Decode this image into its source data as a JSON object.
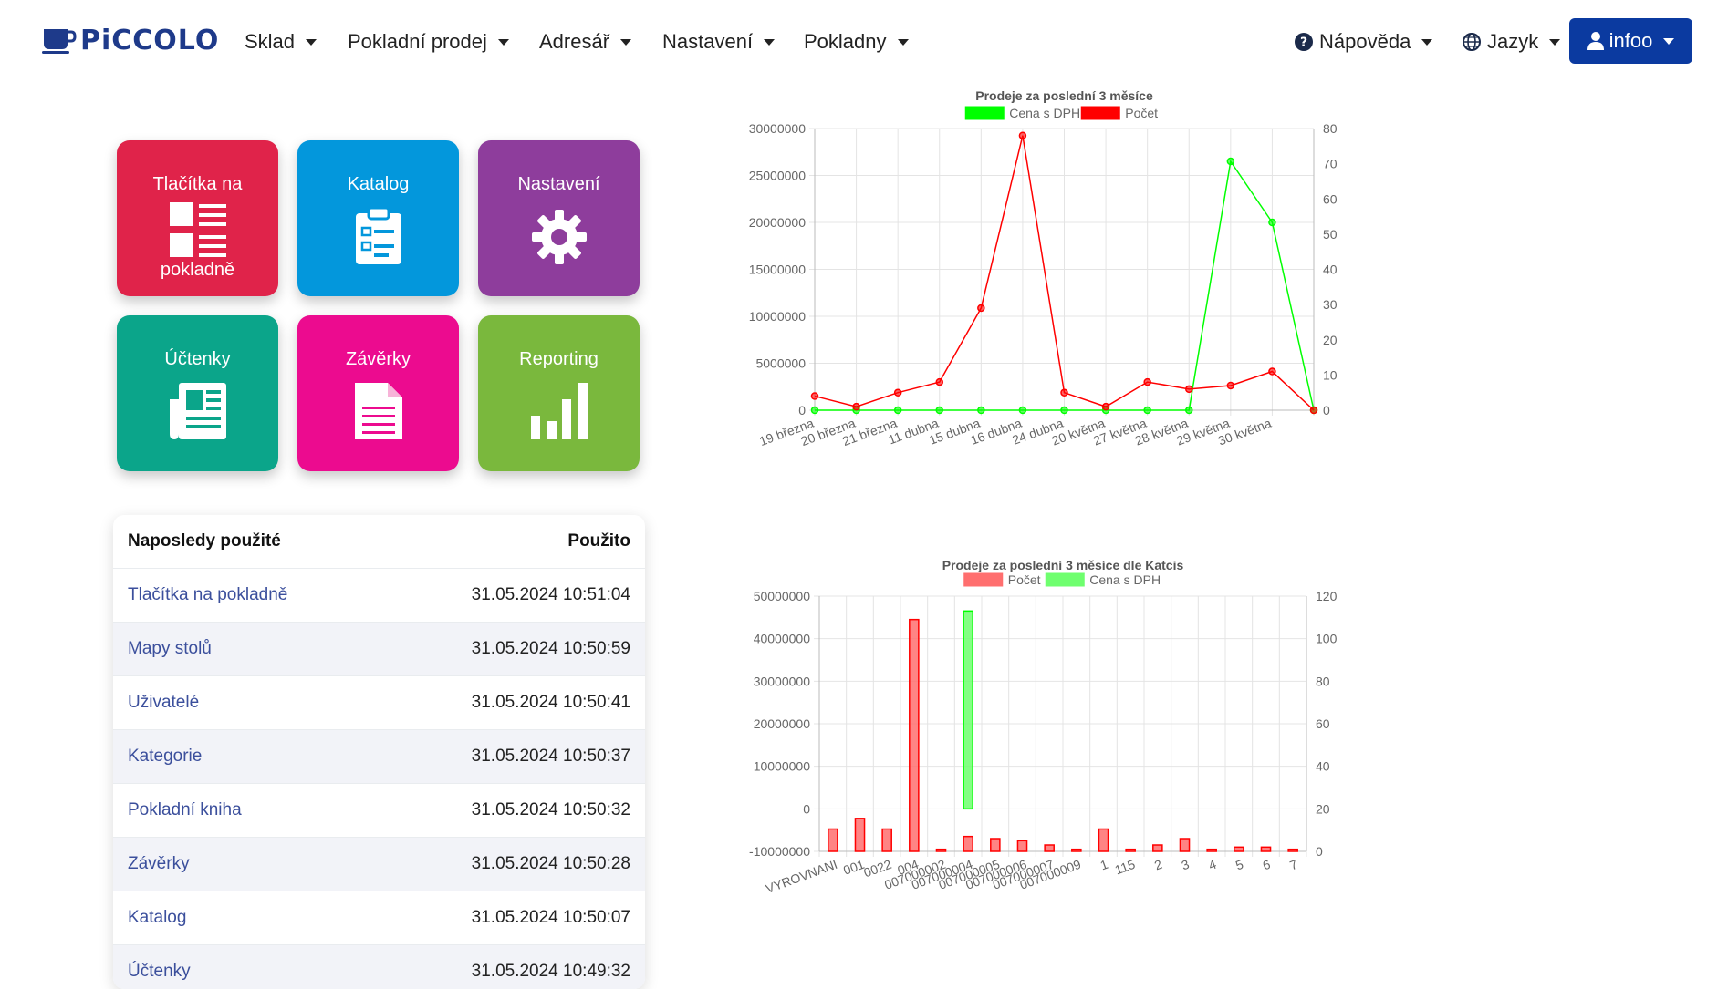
{
  "brand": {
    "name": "PiCCOLO",
    "color": "#1e3a8a"
  },
  "nav": {
    "items": [
      {
        "label": "Sklad"
      },
      {
        "label": "Pokladní prodej"
      },
      {
        "label": "Adresář"
      },
      {
        "label": "Nastavení"
      },
      {
        "label": "Pokladny"
      }
    ],
    "help": "Nápověda",
    "language": "Jazyk",
    "user": "infoo",
    "user_color": "#0b3aa0"
  },
  "tiles": [
    {
      "label": "Tlačítka na",
      "label2": "pokladně",
      "color": "#e0234a",
      "icon": "pos-buttons-icon"
    },
    {
      "label": "Katalog",
      "color": "#0397dc",
      "icon": "clipboard-list-icon"
    },
    {
      "label": "Nastavení",
      "color": "#8e3d9c",
      "icon": "gear-icon"
    },
    {
      "label": "Účtenky",
      "color": "#0ba58a",
      "icon": "newspaper-icon"
    },
    {
      "label": "Závěrky",
      "color": "#ec0b8f",
      "icon": "document-icon"
    },
    {
      "label": "Reporting",
      "color": "#7ab83d",
      "icon": "bar-chart-icon"
    }
  ],
  "recent": {
    "header_name": "Naposledy použité",
    "header_time": "Použito",
    "rows": [
      {
        "name": "Tlačítka na pokladně",
        "time": "31.05.2024 10:51:04"
      },
      {
        "name": "Mapy stolů",
        "time": "31.05.2024 10:50:59"
      },
      {
        "name": "Uživatelé",
        "time": "31.05.2024 10:50:41"
      },
      {
        "name": "Kategorie",
        "time": "31.05.2024 10:50:37"
      },
      {
        "name": "Pokladní kniha",
        "time": "31.05.2024 10:50:32"
      },
      {
        "name": "Závěrky",
        "time": "31.05.2024 10:50:28"
      },
      {
        "name": "Katalog",
        "time": "31.05.2024 10:50:07"
      },
      {
        "name": "Účtenky",
        "time": "31.05.2024 10:49:32"
      }
    ]
  },
  "chart_data": [
    {
      "type": "line",
      "title": "Prodeje za poslední 3 měsíce",
      "categories": [
        "19 března",
        "20 března",
        "21 března",
        "11 dubna",
        "15 dubna",
        "16 dubna",
        "24 dubna",
        "20 května",
        "27 května",
        "28 května",
        "29 května",
        "30 května",
        ""
      ],
      "series": [
        {
          "name": "Cena s DPH",
          "color": "#00ff00",
          "axis": "left",
          "values": [
            0,
            0,
            0,
            0,
            0,
            0,
            0,
            0,
            0,
            0,
            26500000,
            20000000,
            0
          ]
        },
        {
          "name": "Počet",
          "color": "#ff0000",
          "axis": "right",
          "values": [
            4,
            1,
            5,
            8,
            29,
            78,
            5,
            1,
            8,
            6,
            7,
            11,
            0
          ]
        }
      ],
      "y_left": {
        "min": 0,
        "max": 30000000,
        "ticks": [
          0,
          5000000,
          10000000,
          15000000,
          20000000,
          25000000,
          30000000
        ]
      },
      "y_right": {
        "min": 0,
        "max": 80,
        "ticks": [
          0,
          10,
          20,
          30,
          40,
          50,
          60,
          70,
          80
        ]
      },
      "grid": true,
      "legend": "top"
    },
    {
      "type": "bar",
      "title": "Prodeje za poslední 3 měsíce dle Katcis",
      "categories": [
        "VYROVNANI",
        "001",
        "0022",
        "004",
        "007000002",
        "007000004",
        "007000005",
        "007000006",
        "007000007",
        "007000009",
        "1",
        "115",
        "2",
        "3",
        "4",
        "5",
        "6",
        "7"
      ],
      "series": [
        {
          "name": "Počet",
          "color": "#ff6f6f",
          "axis": "right",
          "values": [
            10.5,
            15.5,
            10.5,
            109,
            1,
            7,
            6,
            5,
            3,
            1,
            10.5,
            1,
            3,
            6,
            1,
            2,
            2,
            1
          ]
        },
        {
          "name": "Cena s DPH",
          "color": "#6fff6f",
          "axis": "left",
          "values": [
            0,
            0,
            0,
            0,
            0,
            46500000,
            0,
            0,
            0,
            0,
            0,
            0,
            0,
            0,
            0,
            0,
            0,
            0
          ]
        }
      ],
      "y_left": {
        "min": -10000000,
        "max": 50000000,
        "ticks": [
          -10000000,
          0,
          10000000,
          20000000,
          30000000,
          40000000,
          50000000
        ]
      },
      "y_right": {
        "min": 0,
        "max": 120,
        "ticks": [
          0,
          20,
          40,
          60,
          80,
          100,
          120
        ]
      },
      "grid": true,
      "legend": "top"
    }
  ]
}
